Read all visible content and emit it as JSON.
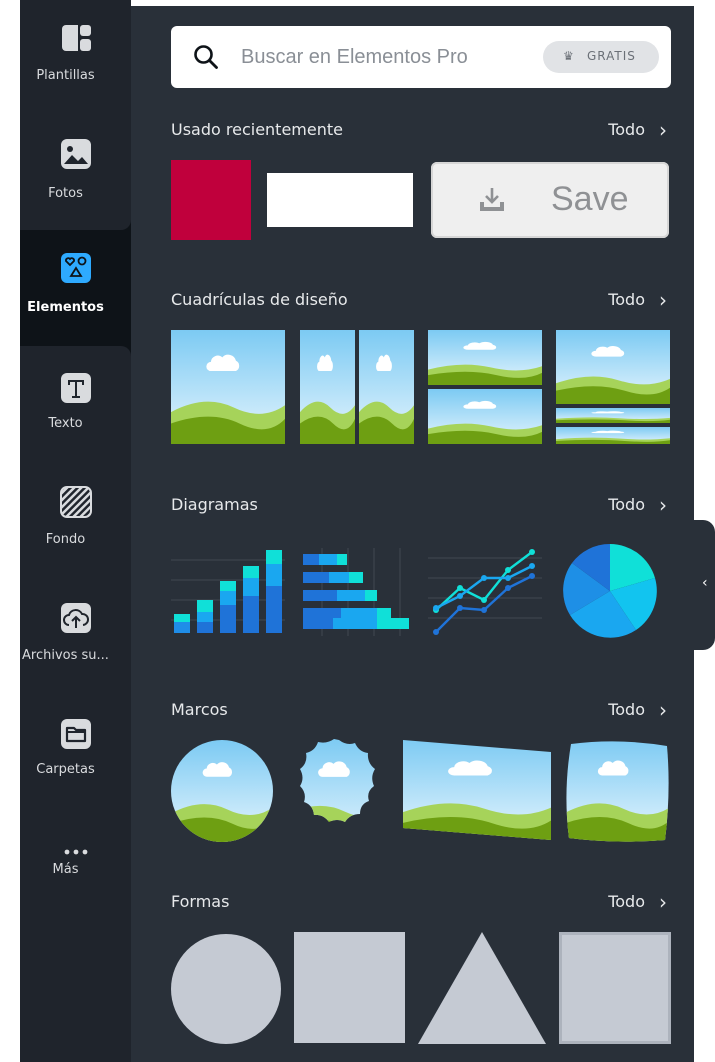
{
  "rail": {
    "items": [
      {
        "label": "Plantillas",
        "icon": "templates-icon"
      },
      {
        "label": "Fotos",
        "icon": "photo-icon"
      },
      {
        "label": "Elementos",
        "icon": "elements-icon",
        "active": true
      },
      {
        "label": "Texto",
        "icon": "text-icon"
      },
      {
        "label": "Fondo",
        "icon": "background-icon"
      },
      {
        "label": "Archivos su...",
        "icon": "upload-icon"
      },
      {
        "label": "Carpetas",
        "icon": "folder-icon"
      },
      {
        "label": "Más",
        "icon": "more-icon"
      }
    ]
  },
  "search": {
    "placeholder": "Buscar en Elementos Pro",
    "badge": "GRATIS"
  },
  "sections": {
    "recent": {
      "title": "Usado recientemente",
      "all": "Todo"
    },
    "grids": {
      "title": "Cuadrículas de diseño",
      "all": "Todo"
    },
    "charts": {
      "title": "Diagramas",
      "all": "Todo"
    },
    "frames": {
      "title": "Marcos",
      "all": "Todo"
    },
    "shapes": {
      "title": "Formas",
      "all": "Todo"
    }
  },
  "recent": {
    "save_label": "Save",
    "colors": {
      "crimson": "#c0003c",
      "white": "#ffffff"
    }
  },
  "colors": {
    "rail": "#1f242c",
    "panel": "#293039",
    "accent": "#2eaaff",
    "shape": "#c5cad3",
    "sky": "#bfe3f9",
    "grass": "#8dc21f"
  }
}
